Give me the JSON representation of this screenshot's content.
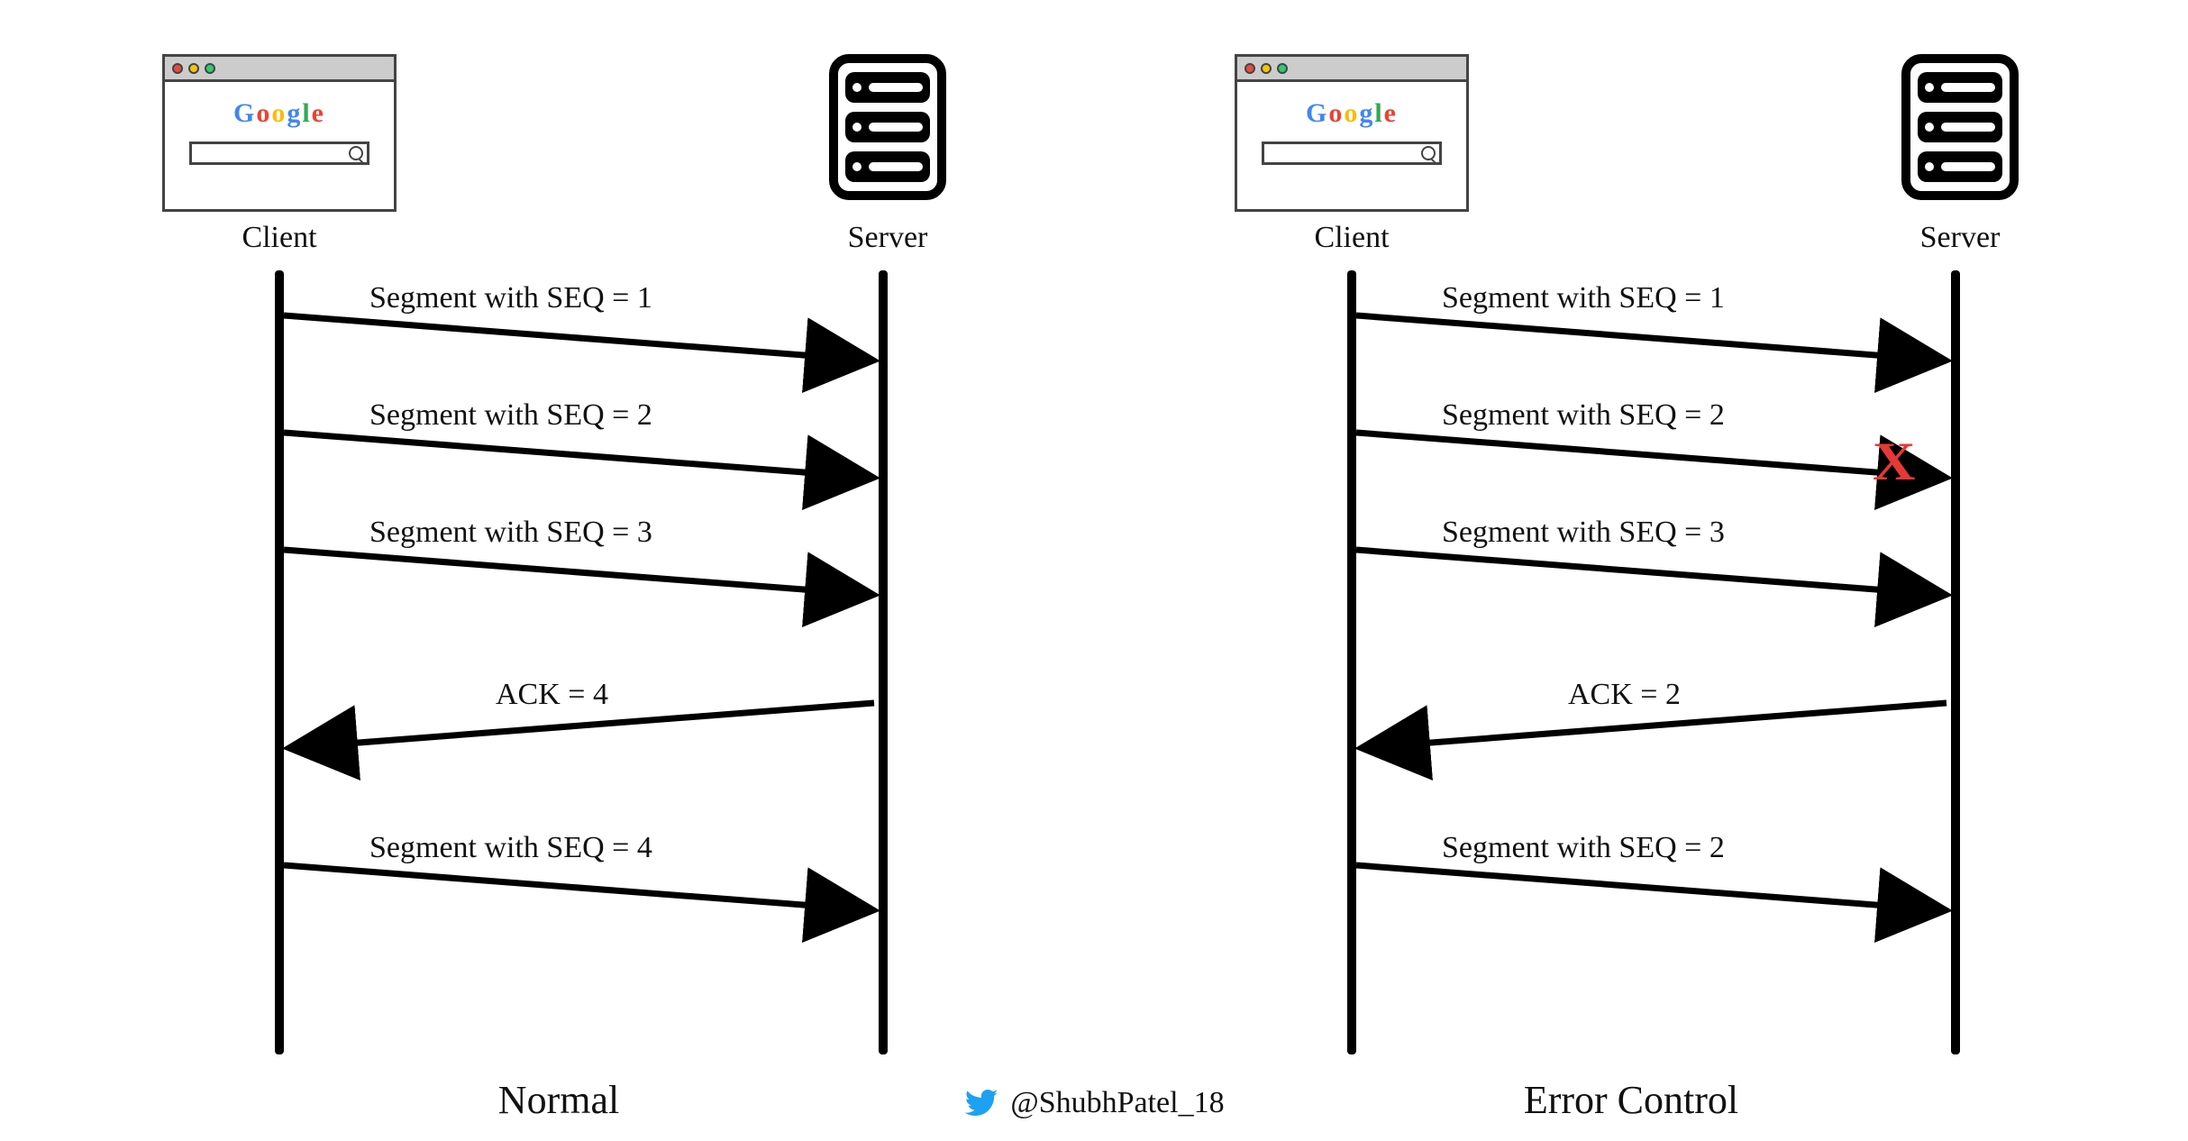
{
  "footer": {
    "handle": "@ShubhPatel_18"
  },
  "panels": {
    "normal": {
      "title": "Normal",
      "client_label": "Client",
      "server_label": "Server",
      "messages": {
        "m1": "Segment with SEQ = 1",
        "m2": "Segment with SEQ = 2",
        "m3": "Segment with SEQ = 3",
        "ack": "ACK = 4",
        "m4": "Segment with SEQ = 4"
      }
    },
    "error": {
      "title": "Error Control",
      "client_label": "Client",
      "server_label": "Server",
      "messages": {
        "m1": "Segment with SEQ = 1",
        "m2": "Segment with SEQ = 2",
        "m3": "Segment with SEQ = 3",
        "ack": "ACK = 2",
        "m4": "Segment with SEQ = 2"
      }
    }
  }
}
